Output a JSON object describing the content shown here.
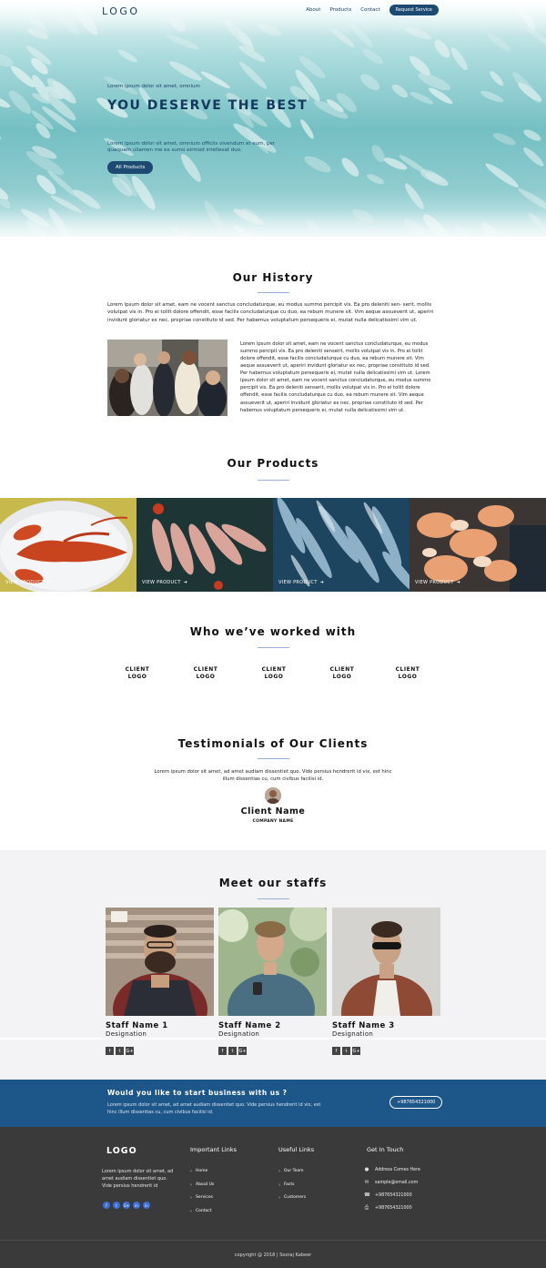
{
  "header": {
    "logo": "LOGO",
    "nav": [
      "About",
      "Products",
      "Contact"
    ],
    "request_button": "Request Service"
  },
  "hero": {
    "kicker": "Lorem ipsum dolor sit amet, omnium",
    "title": "YOU DESERVE THE BEST",
    "description": "Lorem ipsum dolor sit amet, omnium officiis vivendum et eum, per quaquam ullamen me ex sumo eirmod intellexat duo.",
    "button": "All Products"
  },
  "history": {
    "title": "Our History",
    "paragraph1": "Lorem ipsum dolor sit amet, eam ne vocent sanctus concludaturque, eu modus summo percipit vis. Ea pro deleniti sen- serit, mollis volutpat vis in. Pro ei tollit dolore offendit, esse facilis concludaturque cu duo, ea rebum munere sit. Vim aeque assueverit ut, aperiri invidunt gloriatur ex nec, propriae constituto id sed. Per habemus voluptatum persequeris ei, mutat nulla delicatissimi vim ut.",
    "paragraph2": "Lorem ipsum dolor sit amet, eam ne vocent sanctus concludaturque, eu modus summo percipit vis. Ea pro deleniti senserit, mollis volutpat vis in. Pro ei tollit dolore offendit, esse facilis concludaturque cu duo, ea rebum munere sit. Vim aeque assueverit ut, aperiri invidunt gloriatur ex nec, propriae constituto id sed. Per habemus voluptatum persequeris ei, mutat nulla delicatissimi vim ut. Lorem ipsum dolor sit amet, eam ne vocent sanctus concludaturque, eu modus summo percipit vis. Ea pro deleniti senserit, mollis volutpat vis in. Pro ei tollit dolore offendit, esse facilis concludaturque cu duo, ea rebum munere sit. Vim aeque assueverit ut, aperiri invidunt gloriatur ex nec, propriae constituto id sed. Per habemus voluptatum persequeris ei, mutat nulla delicatissimi vim ut."
  },
  "products": {
    "title": "Our Products",
    "items": [
      {
        "label": "VIEW PRODUCT"
      },
      {
        "label": "VIEW PRODUCT"
      },
      {
        "label": "VIEW PRODUCT"
      },
      {
        "label": "VIEW PRODUCT"
      }
    ]
  },
  "clients": {
    "title": "Who we’ve worked with",
    "logos": [
      {
        "line1": "CLIENT",
        "line2": "LOGO"
      },
      {
        "line1": "CLIENT",
        "line2": "LOGO"
      },
      {
        "line1": "CLIENT",
        "line2": "LOGO"
      },
      {
        "line1": "CLIENT",
        "line2": "LOGO"
      },
      {
        "line1": "CLIENT",
        "line2": "LOGO"
      }
    ]
  },
  "testimonials": {
    "title": "Testimonials of Our Clients",
    "quote": "Lorem ipsum dolor sit amet, ad amet audiam dissentiet quo. Vide persius hendrerit id vix, est hinc illum dissentias cu, cum civibus facilisi id.",
    "client_name": "Client Name",
    "company_name": "COMPANY NAME"
  },
  "staff": {
    "title": "Meet our staffs",
    "members": [
      {
        "name": "Staff Name 1",
        "designation": "Designation"
      },
      {
        "name": "Staff Name 2",
        "designation": "Designation"
      },
      {
        "name": "Staff Name 3",
        "designation": "Designation"
      }
    ],
    "social_glyphs": [
      "f",
      "t",
      "G+"
    ]
  },
  "cta": {
    "title": "Would you like to start business with us ?",
    "text": "Lorem ipsum dolor sit amet, ad amet audiam dissentiet quo. Vide persius hendrerit id vix, est hinc illum dissentias cu, cum civibus facilisi id.",
    "phone": "+987654321000"
  },
  "footer": {
    "logo": "LOGO",
    "about": "Lorem ipsum dolor sit amet, ad amet audiam dissentiet quo. Vide persius hendrerit id",
    "social_glyphs": [
      "f",
      "t",
      "G+",
      "in",
      "in"
    ],
    "important_links_title": "Important Links",
    "important_links": [
      "Home",
      "About Us",
      "Services",
      "Contact"
    ],
    "useful_links_title": "Useful Links",
    "useful_links": [
      "Our Team",
      "Facts",
      "Customers"
    ],
    "get_in_touch_title": "Get In Touch",
    "contact": {
      "address": "Address Comes Here",
      "email": "sample@email.com",
      "phone": "+987654321000",
      "fax": "+987654321000"
    },
    "copyright": "copyright @ 2018 | Sooraj Kabeer"
  },
  "colors": {
    "brand_dark": "#1d4a72",
    "cta_blue": "#1d5688",
    "footer_bg": "#3a3a3a",
    "accent_line": "#9ab0d8",
    "social_blue": "#3b6fd6"
  }
}
